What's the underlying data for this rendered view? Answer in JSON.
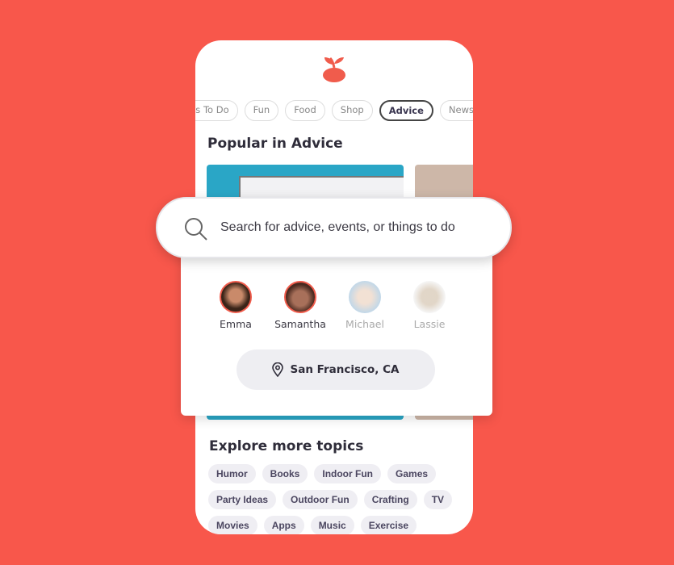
{
  "colors": {
    "background": "#f8574b",
    "brand": "#f05c4c"
  },
  "logo": {
    "icon": "cherry-logo"
  },
  "categories": [
    {
      "label": "gs To Do"
    },
    {
      "label": "Fun"
    },
    {
      "label": "Food"
    },
    {
      "label": "Shop"
    },
    {
      "label": "Advice",
      "active": true
    },
    {
      "label": "News"
    }
  ],
  "popular_title": "Popular in Advice",
  "search": {
    "placeholder": "Search for advice, events, or things to do",
    "icon": "search-icon"
  },
  "profiles": [
    {
      "name": "Emma",
      "active": true
    },
    {
      "name": "Samantha",
      "active": true
    },
    {
      "name": "Michael",
      "active": false
    },
    {
      "name": "Lassie",
      "active": false
    }
  ],
  "location": {
    "label": "San Francisco, CA",
    "icon": "map-pin-icon"
  },
  "explore_title": "Explore more topics",
  "topics": [
    "Humor",
    "Books",
    "Indoor Fun",
    "Games",
    "Party Ideas",
    "Outdoor Fun",
    "Crafting",
    "TV",
    "Movies",
    "Apps",
    "Music",
    "Exercise"
  ]
}
